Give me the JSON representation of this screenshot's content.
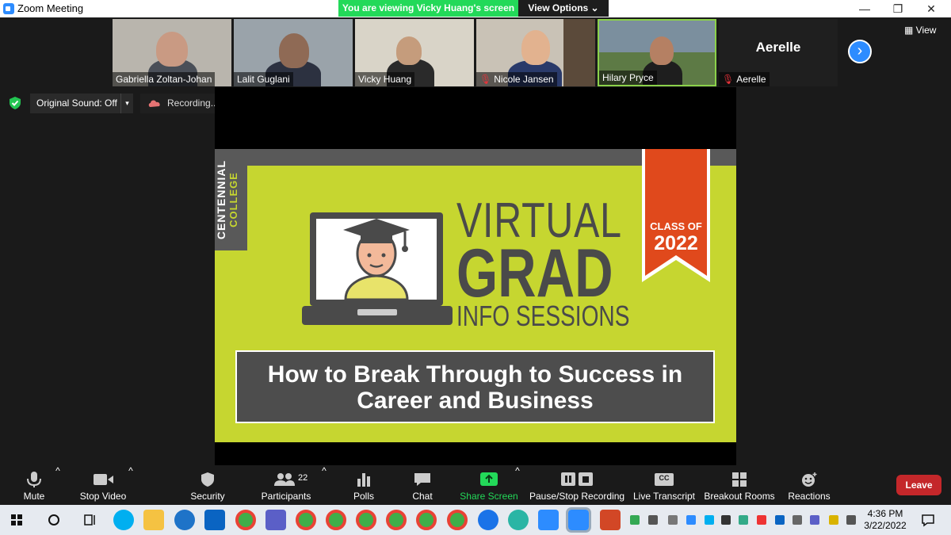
{
  "window": {
    "title": "Zoom Meeting",
    "min": "—",
    "max": "❐",
    "close": "✕"
  },
  "banner": {
    "viewing": "You are viewing Vicky Huang's screen",
    "view_options": "View Options ⌄"
  },
  "gallery": {
    "participants": [
      {
        "name": "Gabriella Zoltan-Johan",
        "muted": false
      },
      {
        "name": "Lalit Guglani",
        "muted": false
      },
      {
        "name": "Vicky Huang",
        "muted": false
      },
      {
        "name": "Nicole Jansen",
        "muted": true
      },
      {
        "name": "Hilary Pryce",
        "muted": false
      },
      {
        "name": "Aerelle",
        "muted": true
      }
    ],
    "aerelle_big": "Aerelle",
    "view_label": "View",
    "next_arrow": "›"
  },
  "audio": {
    "original_sound": "Original Sound: Off",
    "dropdown": "▾",
    "recording": "Recording...",
    "pause": "❚❚"
  },
  "slide": {
    "college_line1": "CENTENNIAL",
    "college_line2": "COLLEGE",
    "virtual": "VIRTUAL",
    "grad": "GRAD",
    "info": "INFO SESSIONS",
    "class_of": "CLASS OF",
    "class_year": "2022",
    "subtitle_line1": "How to Break Through to Success in",
    "subtitle_line2": "Career and Business"
  },
  "toolbar": {
    "mute": "Mute",
    "stop_video": "Stop Video",
    "security": "Security",
    "participants": "Participants",
    "participants_count": "22",
    "polls": "Polls",
    "chat": "Chat",
    "share_screen": "Share Screen",
    "pause_stop_recording": "Pause/Stop Recording",
    "live_transcript": "Live Transcript",
    "cc": "CC",
    "breakout_rooms": "Breakout Rooms",
    "reactions": "Reactions",
    "leave": "Leave",
    "caret": "^"
  },
  "taskbar": {
    "time": "4:36 PM",
    "date": "3/22/2022"
  },
  "colors": {
    "share_green": "#23d959",
    "zoom_blue": "#2d8cff",
    "slide_lime": "#c6d630",
    "ribbon_orange": "#e0491c",
    "leave_red": "#c4272a"
  }
}
